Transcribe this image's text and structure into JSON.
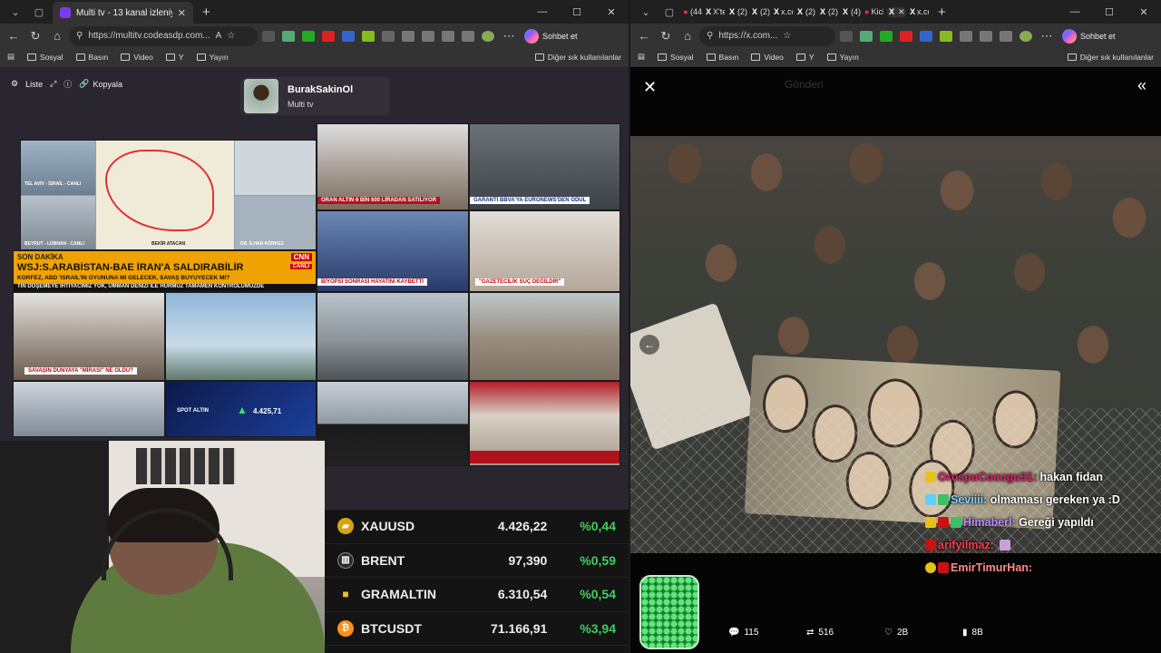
{
  "left_browser": {
    "tab": {
      "title": "Multi tv - 13 kanal izleniyor",
      "favicon_color": "#7c3aed"
    },
    "url": "https://multitv.codeasdp.com...",
    "chat_label": "Sohbet et",
    "bookmarks": [
      "Sosyal",
      "Basın",
      "Video",
      "Y",
      "Yayın"
    ],
    "other_bookmarks": "Diğer sık kullanılanlar"
  },
  "right_browser": {
    "mini_tabs": [
      {
        "icon": "●",
        "text": "(44"
      },
      {
        "icon": "X",
        "text": "X'te"
      },
      {
        "icon": "X",
        "text": "(2)"
      },
      {
        "icon": "X",
        "text": "(2)"
      },
      {
        "icon": "X",
        "text": "x.co"
      },
      {
        "icon": "X",
        "text": "(2)"
      },
      {
        "icon": "X",
        "text": "(2)"
      },
      {
        "icon": "X",
        "text": "(4)"
      },
      {
        "icon": "●",
        "text": "Kick"
      },
      {
        "icon": "X",
        "text": ""
      },
      {
        "icon": "X",
        "text": "x.co"
      }
    ],
    "url": "https://x.com...",
    "chat_label": "Sohbet et",
    "bookmarks": [
      "Sosyal",
      "Basın",
      "Video",
      "Y",
      "Yayın"
    ],
    "other_bookmarks": "Diğer sık kullanılanlar"
  },
  "multitv": {
    "controls": {
      "list": "Liste",
      "copy": "Kopyala"
    },
    "profile": {
      "name": "BurakSakinOl",
      "subtitle": "Multi tv"
    },
    "feeds": {
      "f1_captions": [
        "TEL AVİV - İSRAİL - CANLI",
        "BEYRUT - LÜBNAN - CANLI",
        "BEKİR ATACAN",
        "DR. İLHAN KÖRKEZ"
      ],
      "f2_caption": "ORAN ALTIN 6 BİN 600 LİRADAN SATILIYOR",
      "f3_caption": "GARANTİ BBVA'YA EURONEWS'DEN ÖDÜL",
      "cnn_headline": "WSJ:S.ARABİSTAN-BAE İRAN'A SALDIRABİLİR",
      "cnn_sub": "KÖRFEZ, ABD 'İSRAİL'İN OYUNUNA MI GELECEK, SAVAŞ BÜYÜYECEK Mİ?",
      "cnn_breaking": "SON DAKİKA",
      "cnn_live": "CANLI",
      "cnn_ticker": "TİN DÖŞEMEYE İHTİYACIMIZ YOK, UMMAN DENİZİ İLE HÜRMÜZ TAMAMEN KONTROLÜMÜZDE",
      "f5_caption": "BİYOPSİ SONRASI HAYATINI KAYBETTİ",
      "f6_caption": "\"GAZETECİLİK SUÇ DEĞİLDİR\"",
      "f7_caption": "SAVAŞIN DÜNYAYA \"MİRASI\" NE OLDU?",
      "spot_label": "SPOT ALTIN",
      "spot_value": "4.425,71"
    },
    "prices": [
      {
        "symbol": "XAUUSD",
        "value": "4.426,22",
        "change": "%0,44",
        "coin_color": "#d4a514",
        "coin_icon": "gold-bar-icon"
      },
      {
        "symbol": "BRENT",
        "value": "97,390",
        "change": "%0,59",
        "coin_color": "#2a2a2a",
        "coin_icon": "oil-barrel-icon"
      },
      {
        "symbol": "GRAMALTIN",
        "value": "6.310,54",
        "change": "%0,54",
        "coin_color": "#e8c21a",
        "coin_icon": "gold-square-icon"
      },
      {
        "symbol": "BTCUSDT",
        "value": "71.166,91",
        "change": "%3,94",
        "coin_color": "#f7931a",
        "coin_icon": "bitcoin-icon"
      }
    ]
  },
  "x_media": {
    "header_ghost": "Gönderi",
    "chat": [
      {
        "user": "OrospuCocugu31:",
        "text": " hakan fidan"
      },
      {
        "user": "Seviiii:",
        "text": " olmaması gereken ya :D"
      },
      {
        "user": "Himaberl:",
        "text": " Gereği yapıldı"
      },
      {
        "user": "arifyilmaz:",
        "text": ""
      },
      {
        "user": "EmirTimurHan:",
        "text": ""
      }
    ],
    "actions": {
      "replies": "115",
      "reposts": "516",
      "likes": "2B",
      "views": "8B"
    }
  }
}
